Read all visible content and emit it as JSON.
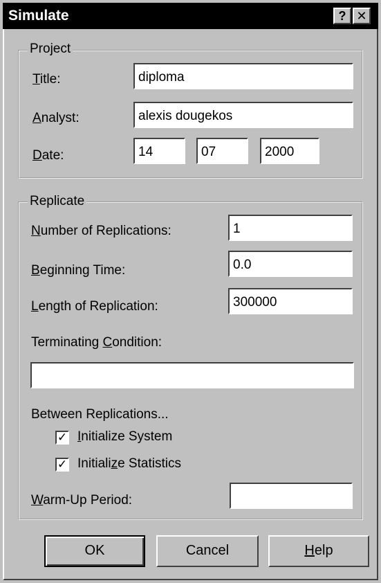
{
  "window": {
    "title": "Simulate",
    "help_glyph": "?",
    "close_glyph": "✕"
  },
  "project": {
    "legend": "Project",
    "title_label": "Title:",
    "title_value": "diploma",
    "analyst_label": "Analyst:",
    "analyst_value": "alexis dougekos",
    "date_label": "Date:",
    "date_day": "14",
    "date_month": "07",
    "date_year": "2000"
  },
  "replicate": {
    "legend": "Replicate",
    "num_replications_label": "Number of Replications:",
    "num_replications_value": "1",
    "beginning_time_label": "Beginning Time:",
    "beginning_time_value": "0.0",
    "length_label": "Length of Replication:",
    "length_value": "300000",
    "terminating_label": "Terminating Condition:",
    "terminating_value": "",
    "between_label": "Between Replications...",
    "init_system_label": "Initialize System",
    "init_system_checked": true,
    "init_stats_label": "Initialize Statistics",
    "init_stats_checked": true,
    "warmup_label": "Warm-Up Period:",
    "warmup_value": ""
  },
  "buttons": {
    "ok": "OK",
    "cancel": "Cancel",
    "help": "Help"
  },
  "colors": {
    "face": "#c0c0c0",
    "titlebar": "#000000",
    "field": "#ffffff"
  }
}
